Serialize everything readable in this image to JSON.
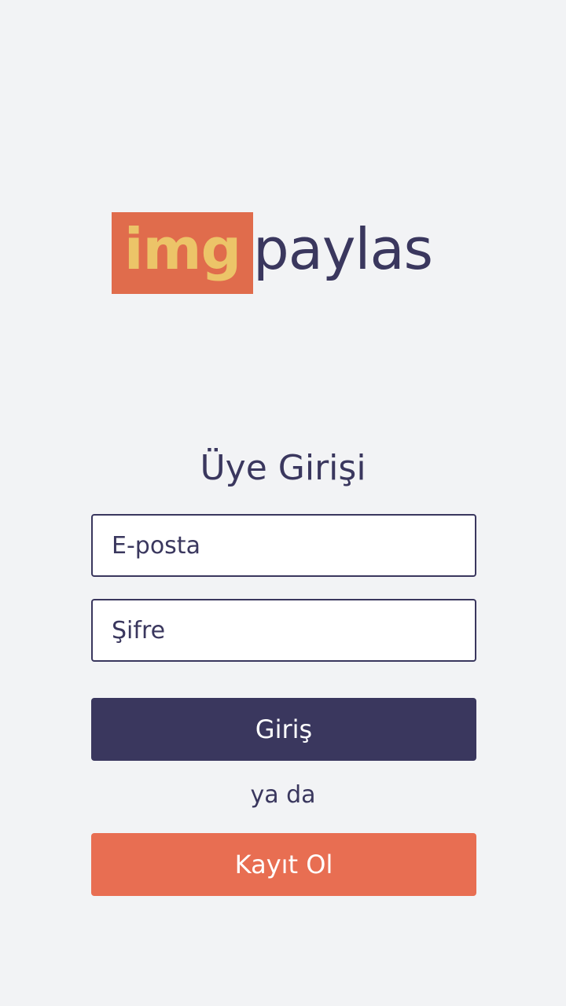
{
  "logo": {
    "highlight": "img",
    "rest": "paylas"
  },
  "title": "Üye Girişi",
  "form": {
    "email_placeholder": "E-posta",
    "password_placeholder": "Şifre"
  },
  "buttons": {
    "login_label": "Giriş",
    "separator": "ya da",
    "register_label": "Kayıt Ol"
  },
  "colors": {
    "background": "#f2f3f5",
    "primary": "#3a375e",
    "accent": "#e86e52",
    "logo_box": "#e06c4c",
    "logo_highlight_text": "#ecc468"
  }
}
